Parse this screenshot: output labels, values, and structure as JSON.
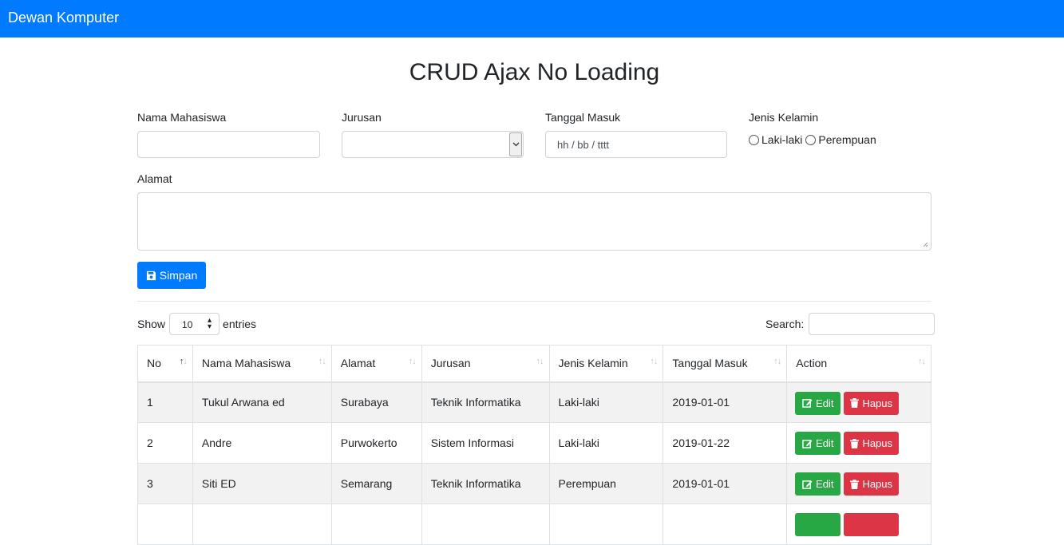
{
  "navbar": {
    "brand": "Dewan Komputer"
  },
  "page": {
    "title": "CRUD Ajax No Loading"
  },
  "form": {
    "nama_label": "Nama Mahasiswa",
    "nama_value": "",
    "jurusan_label": "Jurusan",
    "jurusan_value": "",
    "tanggal_label": "Tanggal Masuk",
    "tanggal_placeholder": "hh / bb / tttt",
    "gender_label": "Jenis Kelamin",
    "gender_options": [
      "Laki-laki",
      "Perempuan"
    ],
    "alamat_label": "Alamat",
    "alamat_value": "",
    "save_label": "Simpan"
  },
  "table_controls": {
    "show_label": "Show",
    "entries_value": "10",
    "entries_label": "entries",
    "search_label": "Search:",
    "search_value": ""
  },
  "table": {
    "columns": [
      "No",
      "Nama Mahasiswa",
      "Alamat",
      "Jurusan",
      "Jenis Kelamin",
      "Tanggal Masuk",
      "Action"
    ],
    "edit_label": "Edit",
    "delete_label": "Hapus",
    "rows": [
      {
        "no": "1",
        "nama": "Tukul Arwana ed",
        "alamat": "Surabaya",
        "jurusan": "Teknik Informatika",
        "gender": "Laki-laki",
        "tanggal": "2019-01-01"
      },
      {
        "no": "2",
        "nama": "Andre",
        "alamat": "Purwokerto",
        "jurusan": "Sistem Informasi",
        "gender": "Laki-laki",
        "tanggal": "2019-01-22"
      },
      {
        "no": "3",
        "nama": "Siti ED",
        "alamat": "Semarang",
        "jurusan": "Teknik Informatika",
        "gender": "Perempuan",
        "tanggal": "2019-01-01"
      },
      {
        "no": "",
        "nama": "",
        "alamat": "",
        "jurusan": "",
        "gender": "",
        "tanggal": ""
      }
    ]
  },
  "colors": {
    "primary": "#007bff",
    "success": "#28a745",
    "danger": "#dc3545",
    "stripe": "#f2f2f2"
  }
}
